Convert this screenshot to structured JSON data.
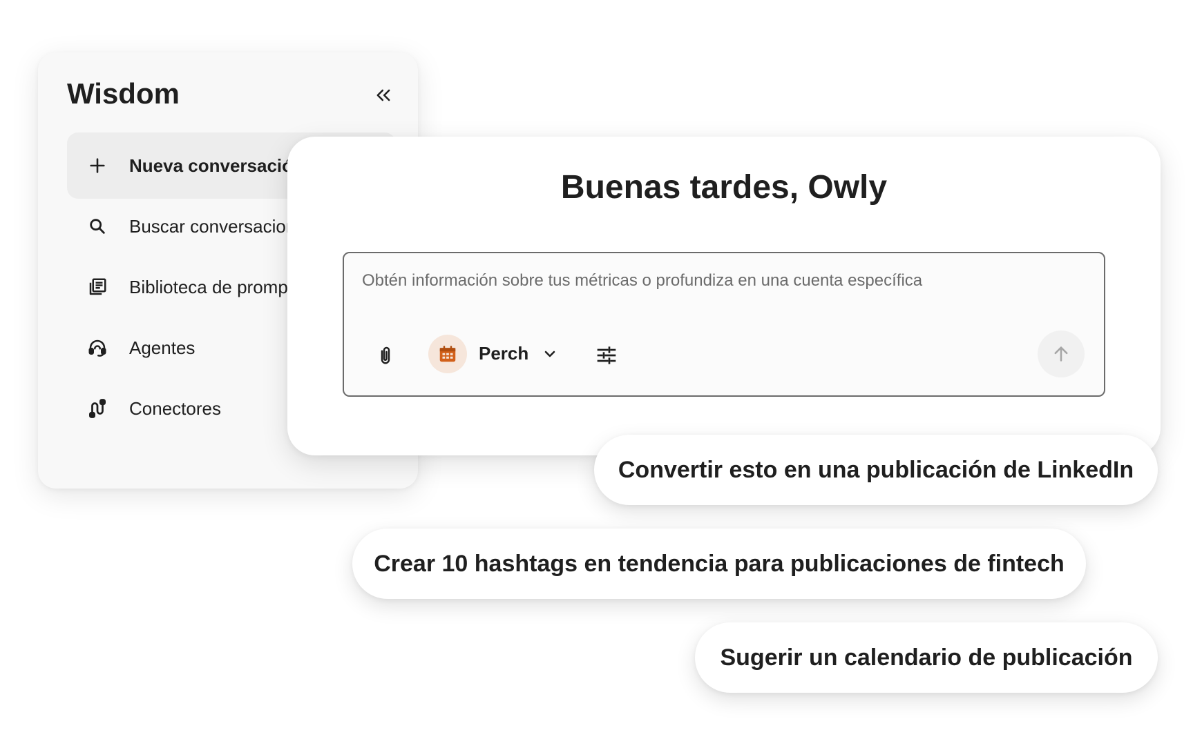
{
  "sidebar": {
    "title": "Wisdom",
    "collapse_icon": "double-chevron-left-icon",
    "items": [
      {
        "label": "Nueva conversación",
        "icon": "plus-icon"
      },
      {
        "label": "Buscar conversaciones",
        "icon": "search-icon"
      },
      {
        "label": "Biblioteca de prompts",
        "icon": "library-icon"
      },
      {
        "label": "Agentes",
        "icon": "agent-headset-icon"
      },
      {
        "label": "Conectores",
        "icon": "connectors-icon"
      }
    ]
  },
  "main": {
    "greeting": "Buenas tardes, Owly",
    "composer": {
      "placeholder": "Obtén información sobre tus métricas o profundiza en una cuenta específica",
      "account_name": "Perch",
      "account_icon": "calendar-icon",
      "accent_color": "#d2601a"
    }
  },
  "suggestions": [
    "Convertir esto en una publicación de LinkedIn",
    "Crear 10 hashtags en tendencia para publicaciones de fintech",
    "Sugerir un calendario de publicación"
  ]
}
